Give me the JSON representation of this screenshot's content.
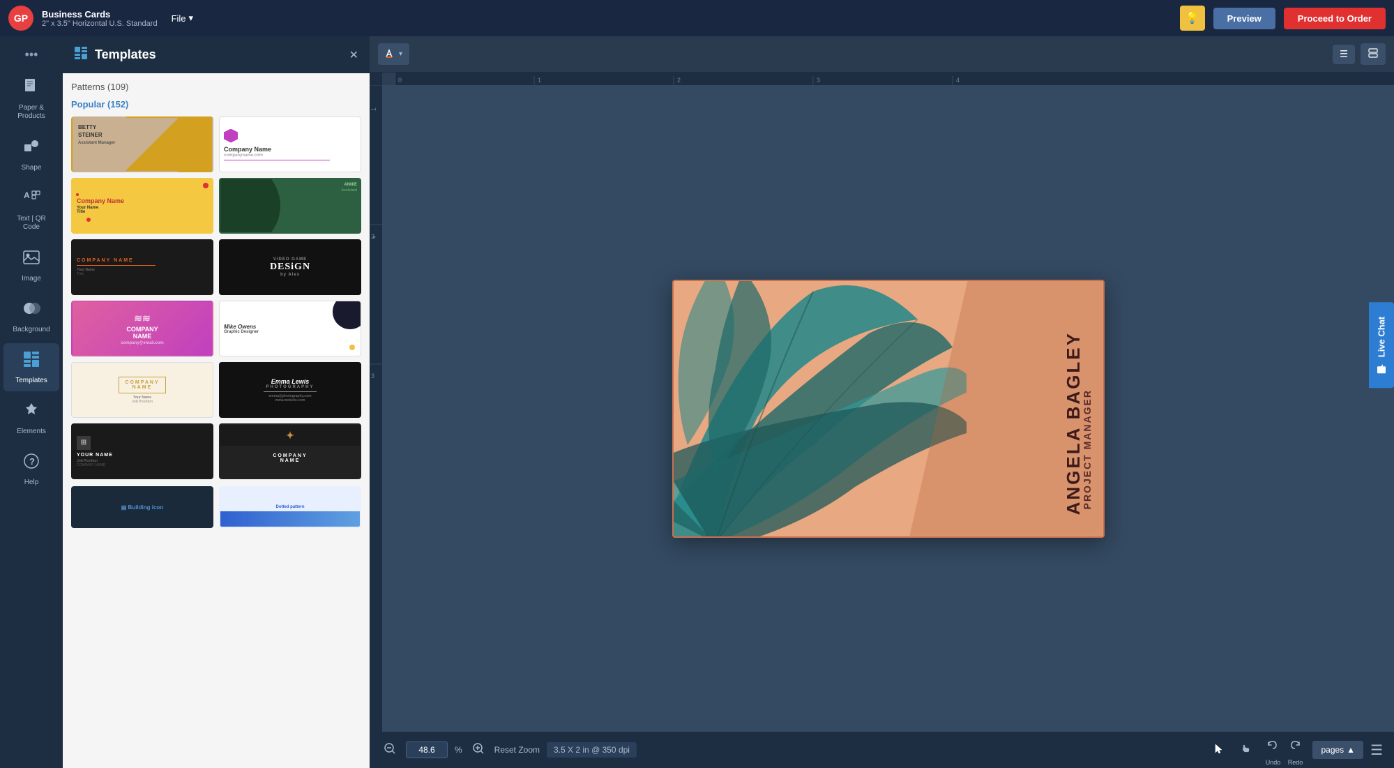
{
  "app": {
    "logo": "GP",
    "title": "Business Cards",
    "subtitle": "2\" x 3.5\" Horizontal U.S. Standard",
    "file_label": "File",
    "file_arrow": "▾"
  },
  "topbar": {
    "light_icon": "💡",
    "preview_label": "Preview",
    "order_label": "Proceed to Order"
  },
  "sidebar": {
    "more_icon": "•••",
    "items": [
      {
        "id": "paper-products",
        "label": "Paper &\nProducts",
        "icon": "📄"
      },
      {
        "id": "shape",
        "label": "Shape",
        "icon": "⬛"
      },
      {
        "id": "text-qr",
        "label": "Text | QR\nCode",
        "icon": "🔤"
      },
      {
        "id": "image",
        "label": "Image",
        "icon": "🖼"
      },
      {
        "id": "background",
        "label": "Background",
        "icon": "🎨"
      },
      {
        "id": "templates",
        "label": "Templates",
        "icon": "⊞",
        "active": true
      },
      {
        "id": "elements",
        "label": "Elements",
        "icon": "🐾"
      },
      {
        "id": "help",
        "label": "Help",
        "icon": "?"
      }
    ]
  },
  "panel": {
    "title": "Templates",
    "icon": "⊞",
    "close_icon": "✕",
    "sections": [
      {
        "id": "patterns",
        "label": "Patterns (109)",
        "active": false
      },
      {
        "id": "popular",
        "label": "Popular (152)",
        "active": true
      }
    ],
    "templates": [
      {
        "id": "t1",
        "style": "t1",
        "preview_text": "BETTY STEINER"
      },
      {
        "id": "t2",
        "style": "t2",
        "preview_text": "Company Name"
      },
      {
        "id": "t3",
        "style": "t3",
        "preview_text": "Company Name"
      },
      {
        "id": "t4",
        "style": "t4",
        "preview_text": "ANNIE..."
      },
      {
        "id": "t5",
        "style": "t5",
        "preview_text": "COMPANY NAME"
      },
      {
        "id": "t6",
        "style": "t6",
        "preview_text": "VIDEO GAME DESIGN"
      },
      {
        "id": "t7",
        "style": "t7",
        "preview_text": "COMPANY NAME"
      },
      {
        "id": "t8",
        "style": "t8",
        "preview_text": "Mike Owens\nGRAPHIC DESIGNER"
      },
      {
        "id": "t9",
        "style": "t9",
        "preview_text": "COMPANY\nNAME"
      },
      {
        "id": "t10",
        "style": "t10",
        "preview_text": "COMPANY\nNAME"
      },
      {
        "id": "t11",
        "style": "t11",
        "preview_text": "Emma Lewis\nPhotography"
      },
      {
        "id": "t12",
        "style": "t12",
        "preview_text": "YOUR NAME"
      }
    ]
  },
  "canvas": {
    "toolbar_icons": [
      "paint-bucket",
      "chevron-down"
    ],
    "hamburger_icon": "☰",
    "layers_icon": "⧉"
  },
  "biz_card": {
    "name": "ANGELA BAGLEY",
    "title": "PROJECT MANAGER",
    "bg_color": "#e8a882",
    "leaf_color": "#2d8080"
  },
  "bottombar": {
    "zoom_in_icon": "⊕",
    "zoom_out_icon": "⊖",
    "zoom_value": "48.6",
    "zoom_pct": "%",
    "zoom_in_icon2": "⊕",
    "reset_zoom_label": "Reset Zoom",
    "dpi_label": "3.5 X 2 in @ 350 dpi",
    "cursor_icon": "↖",
    "hand_icon": "✋",
    "undo_icon": "↺",
    "redo_icon": "↻",
    "undo_label": "Undo",
    "redo_label": "Redo",
    "pages_label": "pages",
    "pages_arrow": "▲",
    "menu_icon": "☰"
  },
  "live_chat": {
    "icon": "💬",
    "label": "Live Chat"
  }
}
